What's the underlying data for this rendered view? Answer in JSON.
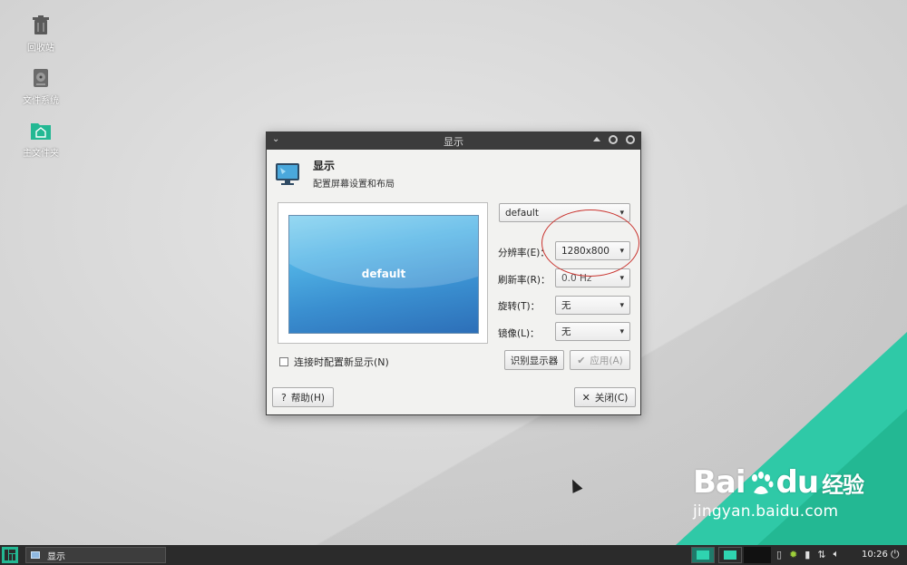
{
  "desktop": {
    "icons": [
      {
        "name": "trash",
        "label": "回收站"
      },
      {
        "name": "filesystem",
        "label": "文件系统"
      },
      {
        "name": "home",
        "label": "主文件夹"
      }
    ]
  },
  "dialog": {
    "title": "显示",
    "header_title": "显示",
    "header_subtitle": "配置屏幕设置和布局",
    "preview_name": "default",
    "output_select": "default",
    "resolution_label": "分辨率(E)：",
    "resolution_value": "1280x800",
    "refresh_label": "刷新率(R)：",
    "refresh_value": "0.0 Hz",
    "rotation_label": "旋转(T)：",
    "rotation_value": "无",
    "mirror_label": "镜像(L)：",
    "mirror_value": "无",
    "checkbox_label": "连接时配置新显示(N)",
    "identify_button": "识别显示器",
    "apply_button": "应用(A)",
    "help_button": "帮助(H)",
    "close_button": "关闭(C)"
  },
  "watermark": {
    "brand_left": "Bai",
    "brand_right": "du",
    "brand_cn": "经验",
    "url": "jingyan.baidu.com"
  },
  "taskbar": {
    "task_label": "显示",
    "clock": "10:26"
  },
  "colors": {
    "accent": "#2fc9a7",
    "highlight": "#c9342f",
    "titlebar": "#3c3c3c"
  }
}
